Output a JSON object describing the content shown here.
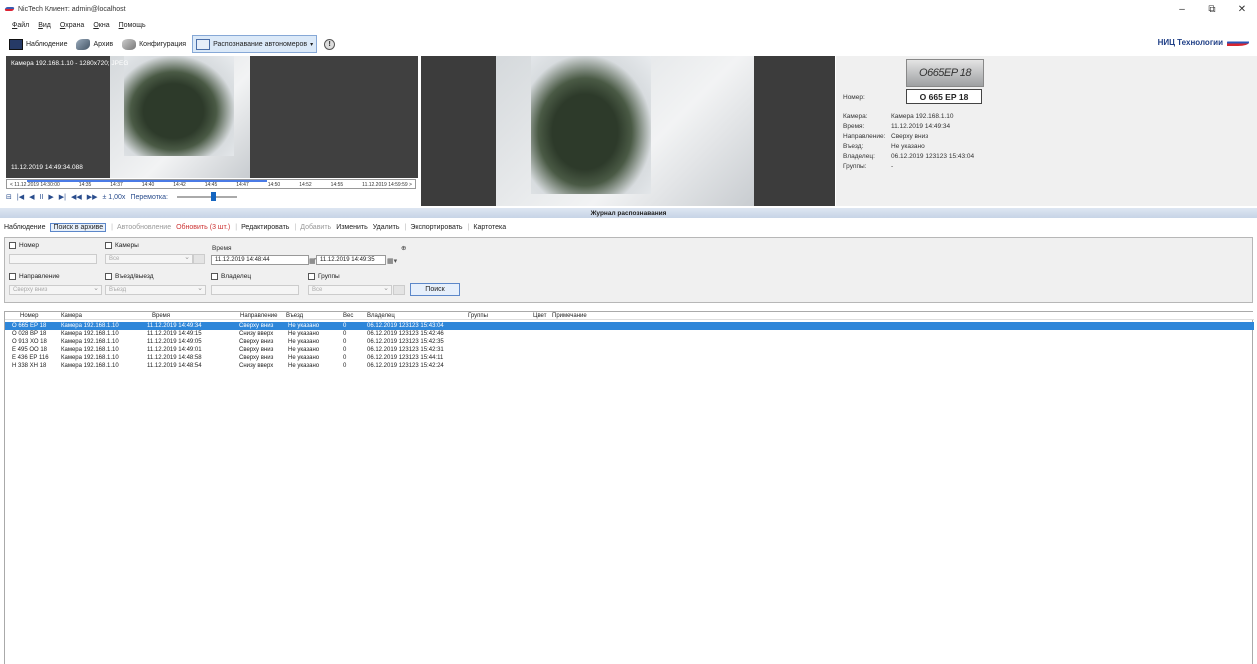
{
  "window": {
    "title": "NicTech Клиент: admin@localhost",
    "controls": {
      "minimize": "–",
      "restore": "⧉",
      "close": "✕"
    }
  },
  "menu": [
    "Файл",
    "Вид",
    "Охрана",
    "Окна",
    "Помощь"
  ],
  "toolbar": {
    "monitoring": "Наблюдение",
    "archive": "Архив",
    "config": "Конфигурация",
    "plate_recognition": "Распознавание автономеров",
    "info": "!",
    "brand": "НИЦ Технологии"
  },
  "video": {
    "camera_label": "Камера 192.168.1.10 - 1280x720; JPEG",
    "timestamp": "11.12.2019 14:49:34.088",
    "timeline": {
      "labels": [
        "< 11.12.2019 14:30:00",
        "14:35",
        "14:37",
        "14:40",
        "14:42",
        "14:45",
        "14:47",
        "14:50",
        "14:52",
        "14:55",
        "11.12.2019 14:59:59 >"
      ],
      "progress_fraction": 0.6
    },
    "controls": [
      "⊟",
      "|◀",
      "◀",
      "II",
      "▶",
      "▶|",
      "◀◀",
      "▶▶",
      "± 1,00x",
      "Перемотка:"
    ]
  },
  "info": {
    "plate_image_text": "O665EP 18",
    "plate": "О 665 ЕР 18",
    "rows": [
      {
        "label": "Номер:",
        "value": ""
      },
      {
        "label": "Камера:",
        "value": "Камера 192.168.1.10"
      },
      {
        "label": "Время:",
        "value": "11.12.2019 14:49:34"
      },
      {
        "label": "Направление:",
        "value": "Сверху вниз"
      },
      {
        "label": "Въезд:",
        "value": "Не указано"
      },
      {
        "label": "Владелец:",
        "value": "06.12.2019 123123 15:43:04"
      },
      {
        "label": "Группы:",
        "value": "-"
      }
    ]
  },
  "journal": {
    "title": "Журнал распознавания",
    "actions": {
      "monitoring": "Наблюдение",
      "archive_search": "Поиск в архиве",
      "autorefresh": "Автообновление",
      "refresh": "Обновить (3 шт.)",
      "edit": "Редактировать",
      "add": "Добавить",
      "change": "Изменить",
      "delete": "Удалить",
      "export": "Экспортировать",
      "card": "Картотека"
    }
  },
  "filter": {
    "number": "Номер",
    "cameras": "Камеры",
    "cameras_value": "Все",
    "time": "Время",
    "time_from": "11.12.2019 14:48:44",
    "time_sep": "-",
    "time_to": "11.12.2019 14:49:35",
    "direction": "Направление",
    "direction_value": "Сверху вниз",
    "entry": "Въезд/выезд",
    "entry_value": "Въезд",
    "owner": "Владелец",
    "groups": "Группы",
    "groups_value": "Все",
    "search_button": "Поиск",
    "collapse": "⊕"
  },
  "table": {
    "columns": [
      "Номер",
      "Камера",
      "Время",
      "Направление",
      "Въезд",
      "Вес",
      "Владелец",
      "Группы",
      "Цвет",
      "Примечание"
    ],
    "rows": [
      [
        "О 665 ЕР 18",
        "Камера 192.168.1.10",
        "11.12.2019 14:49:34",
        "Сверху вниз",
        "Не указано",
        "0",
        "06.12.2019 123123 15:43:04",
        "",
        "",
        ""
      ],
      [
        "О 028 ВР 18",
        "Камера 192.168.1.10",
        "11.12.2019 14:49:15",
        "Снизу вверх",
        "Не указано",
        "0",
        "06.12.2019 123123 15:42:46",
        "",
        "",
        ""
      ],
      [
        "О 913 ХО 18",
        "Камера 192.168.1.10",
        "11.12.2019 14:49:05",
        "Сверху вниз",
        "Не указано",
        "0",
        "06.12.2019 123123 15:42:35",
        "",
        "",
        ""
      ],
      [
        "Е 495 ОО 18",
        "Камера 192.168.1.10",
        "11.12.2019 14:49:01",
        "Сверху вниз",
        "Не указано",
        "0",
        "06.12.2019 123123 15:42:31",
        "",
        "",
        ""
      ],
      [
        "Е 436 ЕР 116",
        "Камера 192.168.1.10",
        "11.12.2019 14:48:58",
        "Сверху вниз",
        "Не указано",
        "0",
        "06.12.2019 123123 15:44:11",
        "",
        "",
        ""
      ],
      [
        "Н 338 ХН 18",
        "Камера 192.168.1.10",
        "11.12.2019 14:48:54",
        "Снизу вверх",
        "Не указано",
        "0",
        "06.12.2019 123123 15:42:24",
        "",
        "",
        ""
      ]
    ],
    "selected_row": 0
  }
}
